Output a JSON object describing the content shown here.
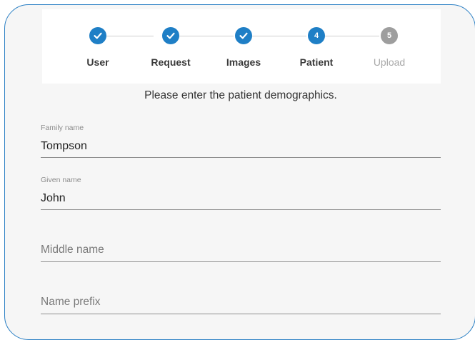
{
  "stepper": {
    "steps": [
      {
        "label": "User",
        "state": "done",
        "number": ""
      },
      {
        "label": "Request",
        "state": "done",
        "number": ""
      },
      {
        "label": "Images",
        "state": "done",
        "number": ""
      },
      {
        "label": "Patient",
        "state": "active",
        "number": "4"
      },
      {
        "label": "Upload",
        "state": "pending",
        "number": "5"
      }
    ]
  },
  "instruction": "Please enter the patient demographics.",
  "form": {
    "family_name": {
      "label": "Family name",
      "value": "Tompson"
    },
    "given_name": {
      "label": "Given name",
      "value": "John"
    },
    "middle_name": {
      "placeholder": "Middle name",
      "value": ""
    },
    "name_prefix": {
      "placeholder": "Name prefix",
      "value": ""
    }
  },
  "colors": {
    "accent": "#1f7fc6",
    "pending": "#9e9e9e",
    "frame_border": "#2a7fc4"
  },
  "icons": {
    "completed_step": "check-icon"
  }
}
